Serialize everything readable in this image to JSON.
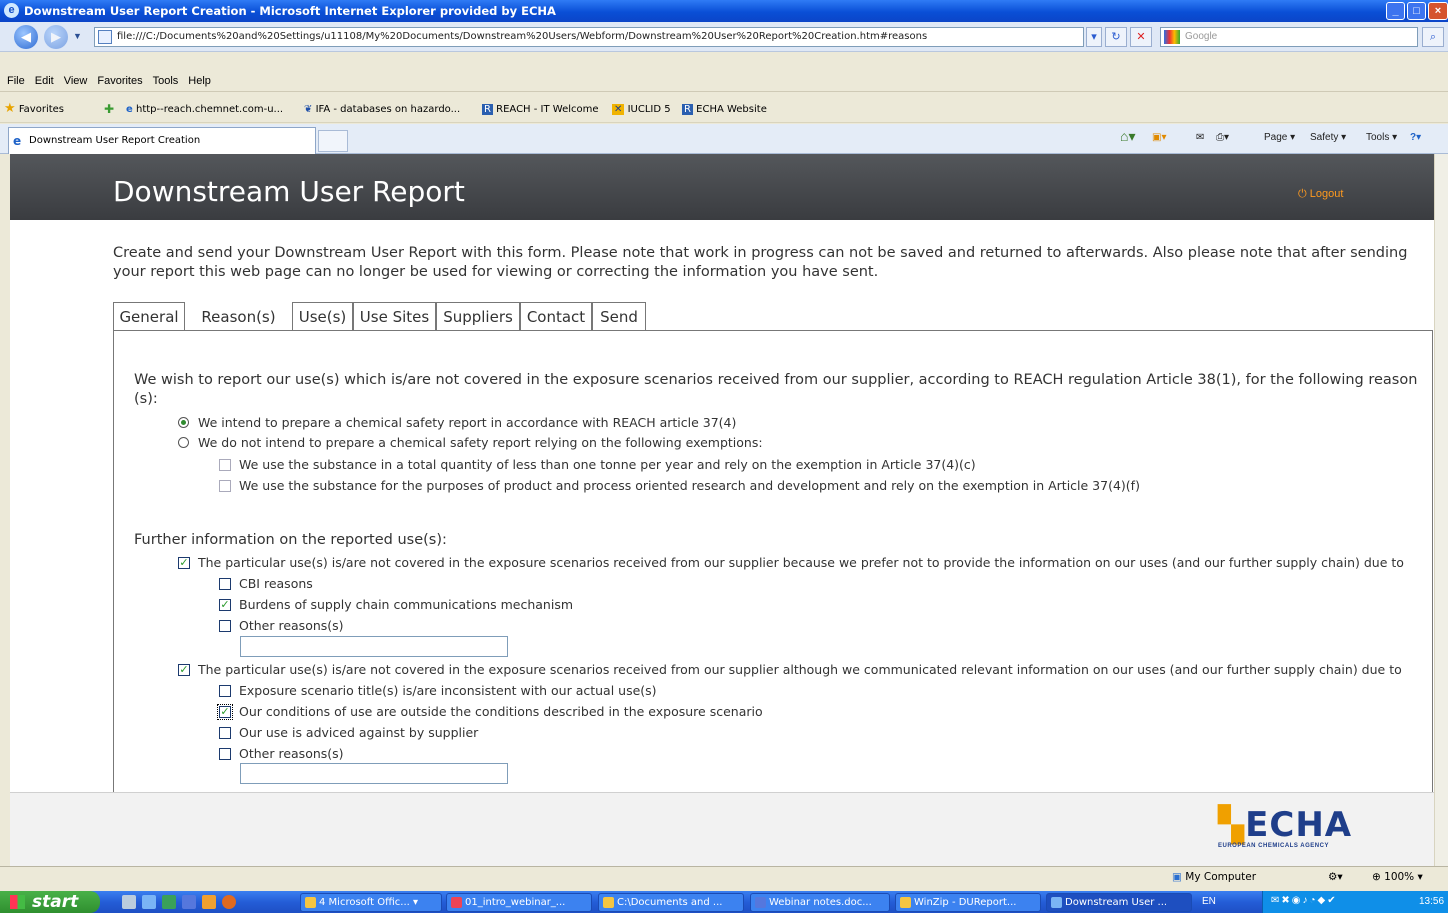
{
  "window": {
    "title": "Downstream User Report Creation - Microsoft Internet Explorer provided by ECHA",
    "address": "file:///C:/Documents%20and%20Settings/u11108/My%20Documents/Downstream%20Users/Webform/Downstream%20User%20Report%20Creation.htm#reasons",
    "search_placeholder": "Google"
  },
  "menu": [
    "File",
    "Edit",
    "View",
    "Favorites",
    "Tools",
    "Help"
  ],
  "favorites": {
    "label": "Favorites",
    "items": [
      "http--reach.chemnet.com-u...",
      "IFA - databases on hazardo...",
      "REACH - IT Welcome",
      "IUCLID 5",
      "ECHA Website"
    ]
  },
  "browser_tab": {
    "label": "Downstream User Report Creation"
  },
  "command_bar": {
    "page": "Page",
    "safety": "Safety",
    "tools": "Tools"
  },
  "page": {
    "title": "Downstream User Report",
    "logout": "Logout",
    "intro": "Create and send your Downstream User Report with this form. Please note that work in progress can not be saved and returned to afterwards. Also please note that after sending your report this web page can no longer be used for viewing or correcting the information you have sent.",
    "tabs": [
      "General",
      "Reason(s)",
      "Use(s)",
      "Use Sites",
      "Suppliers",
      "Contact",
      "Send"
    ],
    "active_tab": "Reason(s)"
  },
  "reasons": {
    "heading": "We wish to report our use(s) which is/are not covered in the exposure scenarios received from our supplier, according to REACH regulation Article 38(1), for the following reason",
    "heading_wrap": "(s):",
    "radio_csr": "We intend to prepare a chemical safety report in accordance with REACH article 37(4)",
    "radio_no_csr": "We do not intend to prepare a chemical safety report relying on the following exemptions:",
    "exempt_tonne": "We use the substance in a total quantity of less than one tonne per year and rely on the exemption in Article 37(4)(c)",
    "exempt_research": "We use the substance for the purposes of product and process oriented research and development and rely on the exemption in Article 37(4)(f)",
    "further_heading": "Further information on the reported use(s):",
    "group1": "The particular use(s) is/are not covered in the exposure scenarios received from our supplier because we prefer not to provide the information on our uses (and our further supply chain) due to",
    "cbi": "CBI reasons",
    "burdens": "Burdens of supply chain communications mechanism",
    "other1": "Other reasons(s)",
    "group2": "The particular use(s) is/are not covered in the exposure scenarios received from our supplier although we communicated relevant information on our uses (and our further supply chain) due to",
    "inconsistent": "Exposure scenario title(s) is/are inconsistent with our actual use(s)",
    "outside": "Our conditions of use are outside the conditions described in the exposure scenario",
    "advised": "Our use is adviced against by supplier",
    "other2": "Other reasons(s)"
  },
  "logo": {
    "word": "ECHA",
    "sub": "EUROPEAN CHEMICALS AGENCY"
  },
  "status": {
    "zone": "My Computer",
    "zoom": "100%"
  },
  "taskbar": {
    "start": "start",
    "items": [
      "4 Microsoft Offic...",
      "01_intro_webinar_...",
      "C:\\Documents and ...",
      "Webinar notes.doc...",
      "WinZip - DUReport...",
      "Downstream User ..."
    ],
    "lang": "EN",
    "clock": "13:56"
  },
  "colors": {
    "accent_orange": "#ff9a1f",
    "header_dark": "#3a3c40",
    "echa_blue": "#1f3e8a"
  }
}
